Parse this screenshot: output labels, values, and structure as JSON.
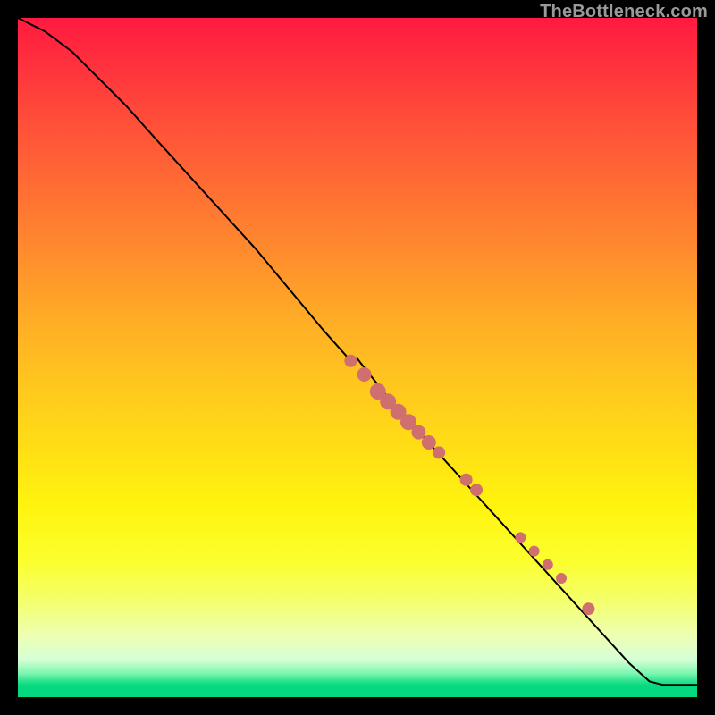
{
  "watermark": "TheBottleneck.com",
  "colors": {
    "curve": "#000000",
    "point_fill": "#cf6f6f",
    "point_stroke": "#b85a5a"
  },
  "chart_data": {
    "type": "line",
    "title": "",
    "xlabel": "",
    "ylabel": "",
    "xlim": [
      0,
      100
    ],
    "ylim": [
      0,
      100
    ],
    "grid": false,
    "curve": [
      {
        "x": 0,
        "y": 100
      },
      {
        "x": 4,
        "y": 98
      },
      {
        "x": 8,
        "y": 95
      },
      {
        "x": 12,
        "y": 91
      },
      {
        "x": 16,
        "y": 87
      },
      {
        "x": 20,
        "y": 82.5
      },
      {
        "x": 25,
        "y": 77
      },
      {
        "x": 30,
        "y": 71.5
      },
      {
        "x": 35,
        "y": 66
      },
      {
        "x": 40,
        "y": 60
      },
      {
        "x": 45,
        "y": 54
      },
      {
        "x": 49,
        "y": 49.5
      },
      {
        "x": 50,
        "y": 49.8
      },
      {
        "x": 51,
        "y": 48.5
      },
      {
        "x": 55,
        "y": 43.5
      },
      {
        "x": 60,
        "y": 38
      },
      {
        "x": 65,
        "y": 32.5
      },
      {
        "x": 70,
        "y": 27
      },
      {
        "x": 75,
        "y": 21.5
      },
      {
        "x": 80,
        "y": 16
      },
      {
        "x": 85,
        "y": 10.5
      },
      {
        "x": 90,
        "y": 5
      },
      {
        "x": 93,
        "y": 2.3
      },
      {
        "x": 95,
        "y": 1.8
      },
      {
        "x": 100,
        "y": 1.8
      }
    ],
    "points": [
      {
        "x": 49,
        "y": 49.5,
        "r": 7
      },
      {
        "x": 51,
        "y": 47.5,
        "r": 8
      },
      {
        "x": 53,
        "y": 45,
        "r": 9
      },
      {
        "x": 54.5,
        "y": 43.5,
        "r": 9
      },
      {
        "x": 56,
        "y": 42,
        "r": 9
      },
      {
        "x": 57.5,
        "y": 40.5,
        "r": 9
      },
      {
        "x": 59,
        "y": 39,
        "r": 8
      },
      {
        "x": 60.5,
        "y": 37.5,
        "r": 8
      },
      {
        "x": 62,
        "y": 36,
        "r": 7
      },
      {
        "x": 66,
        "y": 32,
        "r": 7
      },
      {
        "x": 67.5,
        "y": 30.5,
        "r": 7
      },
      {
        "x": 74,
        "y": 23.5,
        "r": 6
      },
      {
        "x": 76,
        "y": 21.5,
        "r": 6
      },
      {
        "x": 78,
        "y": 19.5,
        "r": 6
      },
      {
        "x": 80,
        "y": 17.5,
        "r": 6
      },
      {
        "x": 84,
        "y": 13,
        "r": 7
      }
    ]
  }
}
